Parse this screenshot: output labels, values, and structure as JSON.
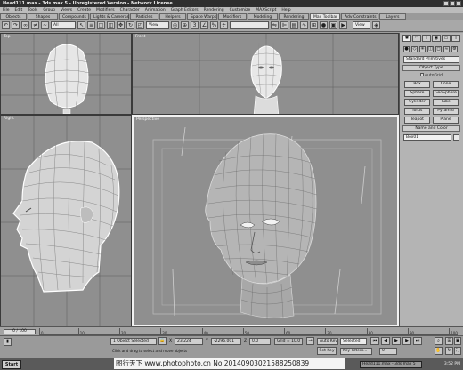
{
  "app": {
    "title": "Head111.max - 3ds max 5 - Unregistered Version - Network License"
  },
  "menu": [
    "File",
    "Edit",
    "Tools",
    "Group",
    "Views",
    "Create",
    "Modifiers",
    "Character",
    "Animation",
    "Graph Editors",
    "Rendering",
    "Customize",
    "MAXScript",
    "Help"
  ],
  "tabs": [
    "Objects",
    "Shapes",
    "Compounds",
    "Lights & Cameras",
    "Particles",
    "Helpers",
    "Space Warps",
    "Modifiers",
    "Modeling",
    "Rendering",
    "Max Toolbar",
    "Adv Constraints",
    "Layers"
  ],
  "active_tab": "Max Toolbar",
  "toolbar": {
    "selection_filter": "All",
    "reference_coord": "View",
    "named_selection": "",
    "viewport_dropdown": "View"
  },
  "viewports": {
    "top": "Top",
    "front": "Front",
    "right": "Right",
    "perspective": "Perspective"
  },
  "panel": {
    "category": "Standard Primitives",
    "object_type_title": "Object Type",
    "autogrid_label": "AutoGrid",
    "objects": [
      "Box",
      "Cone",
      "Sphere",
      "GeoSphere",
      "Cylinder",
      "Tube",
      "Torus",
      "Pyramid",
      "Teapot",
      "Plane"
    ],
    "name_color_title": "Name and Color",
    "name_value": "Box01"
  },
  "timeline": {
    "position": "0 / 100",
    "ticks": [
      "0",
      "10",
      "20",
      "30",
      "40",
      "50",
      "60",
      "70",
      "80",
      "90",
      "100"
    ]
  },
  "status": {
    "selection": "1 Object Selected",
    "x_label": "X",
    "x_value": "23.224",
    "y_label": "Y",
    "y_value": "-2296.001",
    "z_label": "Z",
    "z_value": "0.0",
    "grid": "Grid = 10.0",
    "autokey": "Auto Key",
    "selected": "Selected",
    "setkey": "Set Key",
    "key_filters": "Key Filters...",
    "frame": "0",
    "prompt": "Click and drag to select and move objects"
  },
  "taskbar": {
    "start": "Start",
    "task": "Head111.max - 3ds max 5",
    "clock": "3:52 PM"
  },
  "watermark": "图行天下 www.photophoto.cn  No.20140903021588250839"
}
